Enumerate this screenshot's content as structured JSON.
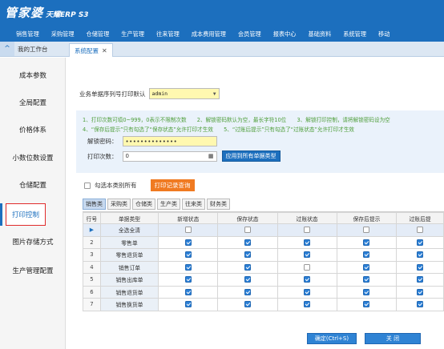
{
  "app": {
    "logo": "管家婆",
    "logo_sub": "天耀ERP S3"
  },
  "nav": [
    "销售管理",
    "采购管理",
    "仓储管理",
    "生产管理",
    "往来管理",
    "成本费用管理",
    "会员管理",
    "报表中心",
    "基础资料",
    "系统管理",
    "移动"
  ],
  "tabs": {
    "home": "我的工作台",
    "active": "系统配置",
    "close_glyph": "✕",
    "collapse_glyph": "^"
  },
  "sidebar": [
    {
      "label": "成本参数"
    },
    {
      "label": "全局配置"
    },
    {
      "label": "价格体系"
    },
    {
      "label": "小数位数设置"
    },
    {
      "label": "仓储配置"
    },
    {
      "label": "打印控制",
      "active": true
    },
    {
      "label": "图片存储方式"
    },
    {
      "label": "生产管理配置"
    }
  ],
  "print_default": {
    "label": "业务单据序列号打印默认",
    "value": "admin"
  },
  "hints": [
    "1、打印次数可填0~999，0表示不限制次数　　2、解锁密码默认为空，最长字符10位　　3、解锁打印控制，请将解锁密码设为空",
    "4、“保存后提示”只有勾选了“保存状态”允许打印才生效　　5、“过账后提示”只有勾选了“过账状态”允许打印才生效"
  ],
  "unlock_password": {
    "label": "解锁密码：",
    "value": "••••••••••••••"
  },
  "print_count": {
    "label": "打印次数：",
    "value": "0"
  },
  "apply_button": "应用到所有单据类型",
  "check_all_label": "勾选本类别所有",
  "print_record_button": "打印记录查询",
  "subtabs": [
    "销售类",
    "采购类",
    "仓储类",
    "生产类",
    "往来类",
    "财务类"
  ],
  "table": {
    "headers": [
      "行号",
      "单据类型",
      "新增状态",
      "保存状态",
      "过账状态",
      "保存后提示",
      "过账后提"
    ],
    "select_all": {
      "marker": "▶",
      "label": "全选全清"
    },
    "rows": [
      {
        "no": "2",
        "type": "零售单",
        "checks": [
          true,
          true,
          true,
          true,
          true
        ]
      },
      {
        "no": "3",
        "type": "零售退货单",
        "checks": [
          true,
          true,
          true,
          true,
          true
        ]
      },
      {
        "no": "4",
        "type": "销售订单",
        "checks": [
          true,
          true,
          false,
          true,
          true
        ]
      },
      {
        "no": "5",
        "type": "销售出库单",
        "checks": [
          true,
          true,
          true,
          true,
          true
        ]
      },
      {
        "no": "6",
        "type": "销售退货单",
        "checks": [
          true,
          true,
          true,
          true,
          true
        ]
      },
      {
        "no": "7",
        "type": "销售换货单",
        "checks": [
          true,
          true,
          true,
          true,
          true
        ]
      }
    ]
  },
  "footer": {
    "confirm": "确定(Ctrl+S)",
    "close": "关 闭"
  }
}
